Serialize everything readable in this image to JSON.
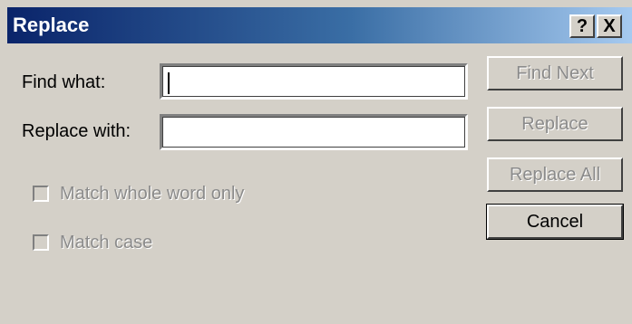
{
  "window": {
    "title": "Replace",
    "help_glyph": "?",
    "close_glyph": "X"
  },
  "fields": {
    "find_label": "Find what:",
    "find_value": "",
    "replace_label": "Replace with:",
    "replace_value": ""
  },
  "options": {
    "whole_word_label": "Match whole word only",
    "whole_word_checked": false,
    "match_case_label": "Match case",
    "match_case_checked": false
  },
  "buttons": {
    "find_next": "Find Next",
    "replace": "Replace",
    "replace_all": "Replace All",
    "cancel": "Cancel"
  }
}
